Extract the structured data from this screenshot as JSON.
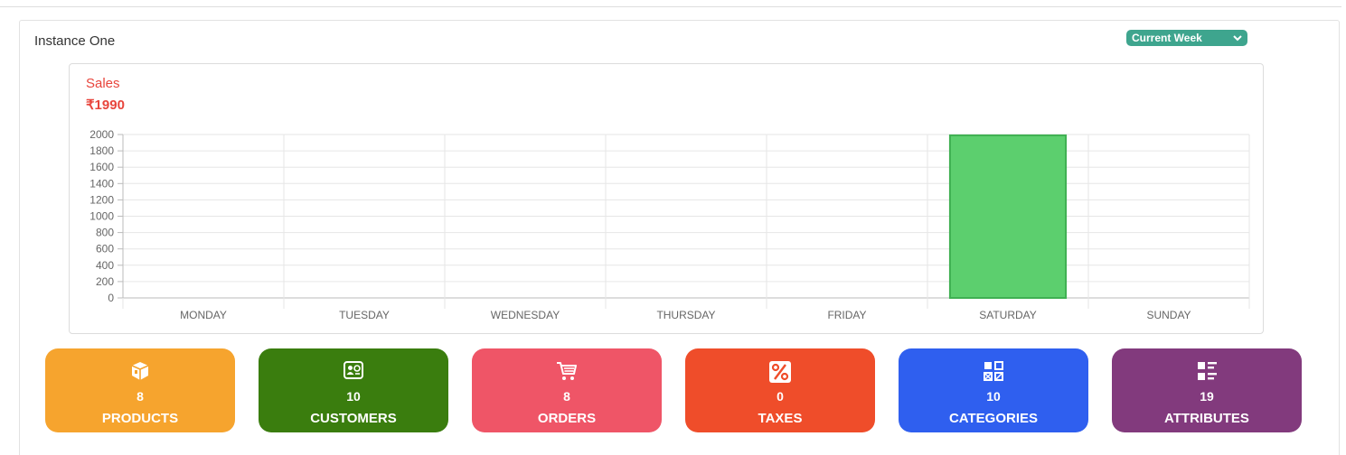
{
  "instance": {
    "title": "Instance One",
    "period_select": "Current Week"
  },
  "sales": {
    "label": "Sales",
    "total": "₹1990"
  },
  "chart_data": {
    "type": "bar",
    "categories": [
      "MONDAY",
      "TUESDAY",
      "WEDNESDAY",
      "THURSDAY",
      "FRIDAY",
      "SATURDAY",
      "SUNDAY"
    ],
    "values": [
      0,
      0,
      0,
      0,
      0,
      1990,
      0
    ],
    "ylim": [
      0,
      2000
    ],
    "yticks": [
      0,
      200,
      400,
      600,
      800,
      1000,
      1200,
      1400,
      1600,
      1800,
      2000
    ],
    "grid": true,
    "bar_color": "#5ccf6e",
    "bar_border": "#3fb052"
  },
  "stats": [
    {
      "count": "8",
      "label": "PRODUCTS",
      "color": "#f6a42e",
      "icon": "box-icon"
    },
    {
      "count": "10",
      "label": "CUSTOMERS",
      "color": "#3a7d0e",
      "icon": "contact-card-icon"
    },
    {
      "count": "8",
      "label": "ORDERS",
      "color": "#ef5567",
      "icon": "cart-icon"
    },
    {
      "count": "0",
      "label": "TAXES",
      "color": "#ef4d2a",
      "icon": "percent-icon"
    },
    {
      "count": "10",
      "label": "CATEGORIES",
      "color": "#2f5fef",
      "icon": "grid-icon"
    },
    {
      "count": "19",
      "label": "ATTRIBUTES",
      "color": "#823a7d",
      "icon": "list-icon"
    }
  ]
}
